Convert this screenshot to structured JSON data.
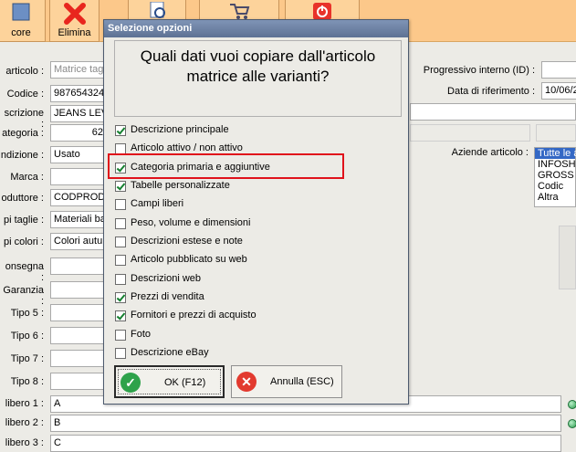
{
  "toolbar": {
    "buttons": [
      {
        "label": "core",
        "icon": "book-icon"
      },
      {
        "label": "Elimina",
        "icon": "delete-x-icon"
      },
      {
        "label": "",
        "icon": "search-doc-icon"
      },
      {
        "label": "",
        "icon": "cart-icon"
      },
      {
        "label": "",
        "icon": "power-icon"
      }
    ]
  },
  "form": {
    "left_labels": [
      "articolo :",
      "Codice :",
      "scrizione :",
      "ategoria :",
      "ndizione :",
      "Marca :",
      "oduttore :",
      "pi taglie :",
      "pi colori :",
      "onsegna :",
      "Garanzia :",
      "Tipo 5 :",
      "Tipo 6 :",
      "Tipo 7 :",
      "Tipo 8 :",
      "libero 1 :",
      "libero 2 :",
      "libero 3 :"
    ],
    "matrice_placeholder": "Matrice tagli",
    "codice": "987654324",
    "descrizione": "JEANS LEVI",
    "categoria": "62",
    "condizione": "Usato",
    "produttore": "CODPROD",
    "taglie": "Materiali bas",
    "colori": "Colori autun",
    "libero1": "A",
    "libero2": "B",
    "libero3": "C",
    "progressivo_label": "Progressivo interno (ID) :",
    "data_rif_label": "Data di riferimento :",
    "data_rif_value": "10/06/2",
    "aziende_label": "Aziende articolo :",
    "aziende": [
      "Tutte le a",
      "INFOSHO",
      "GROSS",
      "Codic",
      "Altra"
    ]
  },
  "dialog": {
    "title": "Selezione opzioni",
    "question": "Quali dati vuoi copiare dall'articolo matrice alle varianti?",
    "options": [
      {
        "label": "Descrizione principale",
        "checked": true
      },
      {
        "label": "Articolo attivo / non attivo",
        "checked": false
      },
      {
        "label": "Categoria primaria e aggiuntive",
        "checked": true
      },
      {
        "label": "Tabelle personalizzate",
        "checked": true
      },
      {
        "label": "Campi liberi",
        "checked": false
      },
      {
        "label": "Peso, volume e dimensioni",
        "checked": false
      },
      {
        "label": "Descrizioni estese e note",
        "checked": false
      },
      {
        "label": "Articolo pubblicato su web",
        "checked": false
      },
      {
        "label": "Descrizioni web",
        "checked": false
      },
      {
        "label": "Prezzi di vendita",
        "checked": true
      },
      {
        "label": "Fornitori e prezzi di acquisto",
        "checked": true
      },
      {
        "label": "Foto",
        "checked": false
      },
      {
        "label": "Descrizione eBay",
        "checked": false
      }
    ],
    "ok_label": "OK (F12)",
    "cancel_label": "Annulla (ESC)"
  },
  "colors": {
    "toolbar": "#fcc88a",
    "highlight": "#e0121b",
    "check": "#15802f"
  }
}
